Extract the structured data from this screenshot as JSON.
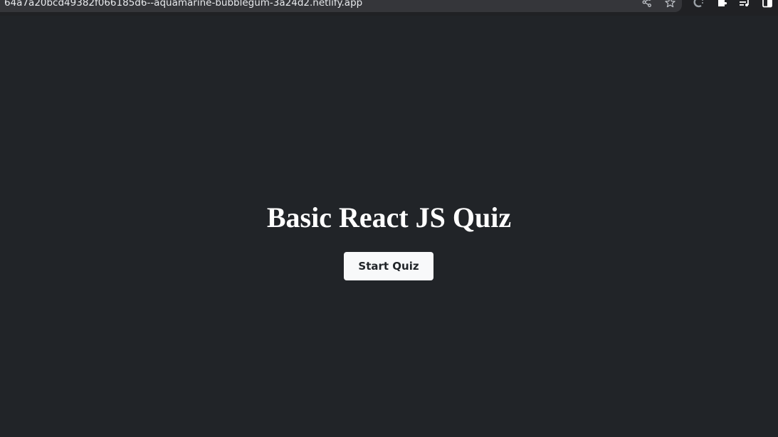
{
  "browser": {
    "url": "64a7a20bcd49382f066185d6--aquamarine-bubblegum-3a24d2.netlify.app",
    "omnibox_icons": [
      "share-icon",
      "bookmark-star-icon"
    ],
    "toolbar_icons": [
      "extension-c-icon",
      "extensions-puzzle-icon",
      "media-playlist-icon",
      "side-panel-icon"
    ]
  },
  "page": {
    "title": "Basic React JS Quiz",
    "start_button_label": "Start Quiz"
  },
  "colors": {
    "page_background": "#212428",
    "title_text": "#ffffff",
    "button_background": "#f8f9fa",
    "button_text": "#212529"
  }
}
